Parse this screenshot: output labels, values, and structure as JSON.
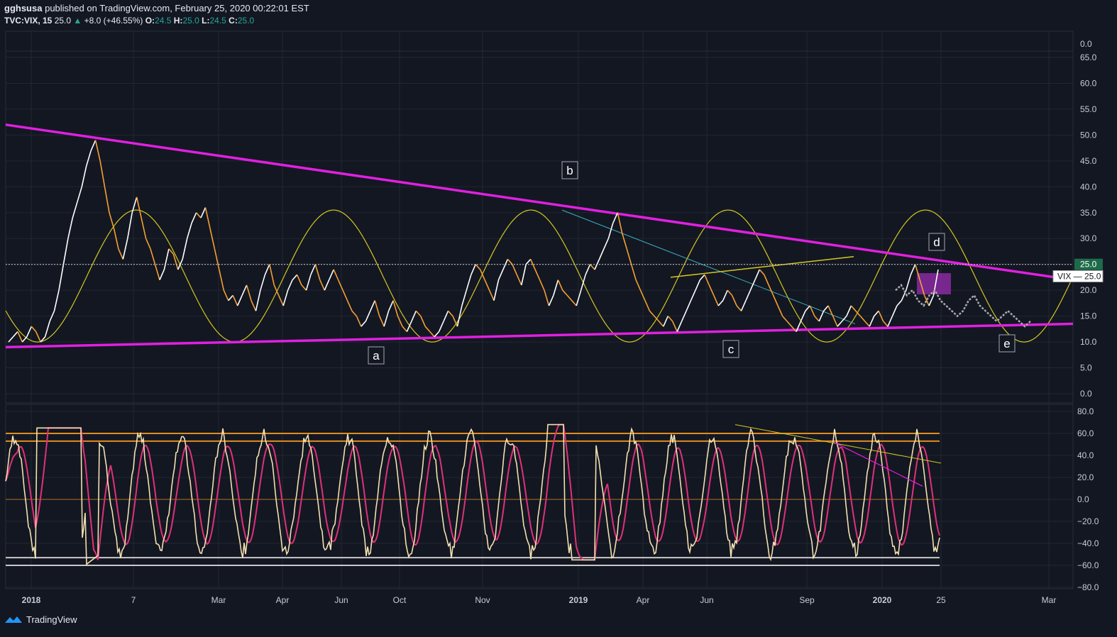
{
  "header": {
    "author": "gghsusa",
    "published_text": "published on TradingView.com, February 25, 2020 00:22:01 EST",
    "symbol": "TVC:VIX, 15",
    "last": "25.0",
    "change": "+8.0 (+46.55%)",
    "o_label": "O:",
    "o_val": "24.5",
    "h_label": "H:",
    "h_val": "25.0",
    "l_label": "L:",
    "l_val": "24.5",
    "c_label": "C:",
    "c_val": "25.0"
  },
  "footer": {
    "brand": "TradingView"
  },
  "colors": {
    "background": "#131722",
    "trendline": "#e020e0",
    "sine": "#d4c820",
    "price_orange": "#f5a030",
    "price_white": "#ffffff",
    "projection": "#aaaaaa",
    "stoch_k": "#f3e0b0",
    "stoch_d": "#e0307a",
    "level_orange": "#e08c20",
    "level_gray": "#c8c8c8",
    "price_marker": "#1e6b4a"
  },
  "chart_data": [
    {
      "type": "line",
      "pane": "price",
      "symbol": "VIX",
      "ylim": [
        0,
        65
      ],
      "y_ticks": [
        "0.0",
        "5.0",
        "10.0",
        "15.0",
        "20.0",
        "25.0",
        "30.0",
        "35.0",
        "40.0",
        "45.0",
        "50.0",
        "55.0",
        "60.0",
        "65.0"
      ],
      "top_tick": "0.0",
      "x_ticks": [
        "2018",
        "7",
        "Mar",
        "Apr",
        "Jun",
        "Oct",
        "Nov",
        "2019",
        "Apr",
        "Jun",
        "Sep",
        "2020",
        "25",
        "Mar"
      ],
      "last_price_label": "25.0",
      "symbol_price_label": "VIX",
      "symbol_price_value": "25.0",
      "wave_labels": [
        "a",
        "b",
        "c",
        "d",
        "e"
      ],
      "series": [
        {
          "values": [
            10,
            11,
            12,
            10,
            11,
            13,
            12,
            10,
            11,
            14,
            16,
            20,
            25,
            30,
            34,
            37,
            40,
            44,
            47,
            49,
            45,
            40,
            35,
            32,
            28,
            26,
            30,
            35,
            38,
            34,
            30,
            28,
            25,
            22,
            24,
            28,
            27,
            24,
            26,
            30,
            33,
            35,
            34,
            36,
            32,
            28,
            24,
            20,
            18,
            19,
            17,
            19,
            21,
            18,
            16,
            20,
            23,
            25,
            21,
            19,
            17,
            20,
            22,
            23,
            21,
            20,
            23,
            25,
            22,
            20,
            22,
            24,
            22,
            20,
            18,
            16,
            15,
            13,
            14,
            16,
            18,
            15,
            13,
            16,
            18,
            15,
            13,
            12,
            14,
            16,
            15,
            13,
            12,
            11,
            12,
            14,
            16,
            15,
            13,
            17,
            20,
            23,
            25,
            24,
            22,
            20,
            18,
            22,
            24,
            26,
            25,
            23,
            21,
            25,
            26,
            24,
            22,
            20,
            17,
            19,
            22,
            20,
            19,
            18,
            17,
            20,
            23,
            25,
            24,
            26,
            28,
            30,
            33,
            35,
            31,
            28,
            25,
            22,
            20,
            18,
            16,
            15,
            14,
            13,
            15,
            14,
            12,
            14,
            16,
            18,
            20,
            22,
            23,
            21,
            19,
            17,
            18,
            20,
            19,
            17,
            16,
            18,
            20,
            22,
            24,
            23,
            21,
            19,
            17,
            15,
            14,
            13,
            12,
            14,
            16,
            17,
            15,
            14,
            16,
            17,
            15,
            13,
            14,
            15,
            17,
            16,
            15,
            14,
            13,
            15,
            16,
            14,
            13,
            15,
            17,
            18,
            20,
            23,
            25,
            22,
            19,
            17,
            19,
            24
          ]
        },
        {
          "name": "projection",
          "values": [
            20,
            21,
            19,
            20,
            18,
            17,
            19,
            20,
            18,
            17,
            16,
            15,
            16,
            18,
            19,
            17,
            16,
            15,
            14,
            15,
            16,
            15,
            14,
            13,
            14
          ]
        },
        {
          "name": "sine",
          "period_points": 6,
          "values": [
            10.0,
            22.5,
            35.5,
            22.5,
            10.0
          ]
        }
      ],
      "trendlines": [
        {
          "name": "upper",
          "from": [
            0,
            52.0
          ],
          "to": [
            1,
            22.0
          ]
        },
        {
          "name": "lower",
          "from": [
            0,
            9.0
          ],
          "to": [
            1,
            13.5
          ]
        }
      ]
    },
    {
      "type": "line",
      "pane": "oscillator",
      "ylim": [
        -80,
        80
      ],
      "y_ticks": [
        "-80.0",
        "-60.0",
        "-40.0",
        "-20.0",
        "0.0",
        "20.0",
        "40.0",
        "60.0",
        "80.0"
      ],
      "levels": [
        60,
        53,
        0,
        -53,
        -60
      ],
      "series": [
        {
          "name": "%K"
        },
        {
          "name": "%D"
        }
      ]
    }
  ]
}
